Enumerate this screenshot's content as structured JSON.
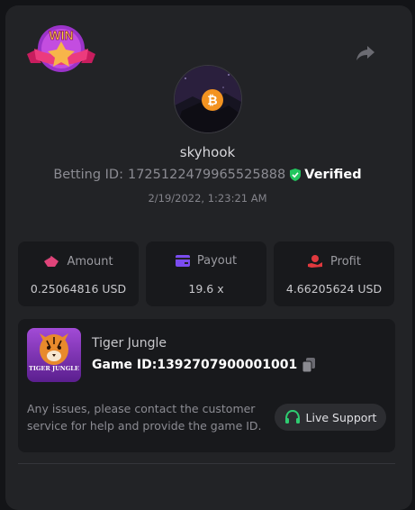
{
  "user": {
    "username": "skyhook",
    "betting_id_label": "Betting ID:",
    "betting_id": "1725122479965525888",
    "verified_label": "Verified",
    "datetime": "2/19/2022, 1:23:21 AM"
  },
  "badge": {
    "text": "WIN"
  },
  "stats": [
    {
      "label": "Amount",
      "value": "0.25064816 USD",
      "icon": "coins-icon",
      "color": "#e0447a"
    },
    {
      "label": "Payout",
      "value": "19.6 x",
      "icon": "wallet-icon",
      "color": "#7b4cf0"
    },
    {
      "label": "Profit",
      "value": "4.66205624 USD",
      "icon": "hand-coin-icon",
      "color": "#e0393e"
    }
  ],
  "game": {
    "name": "Tiger Jungle",
    "id_label": "Game ID:",
    "id": "1392707900001001",
    "thumb_title": "TIGER JUNGLE"
  },
  "support": {
    "message": "Any issues, please contact the customer service for help and provide the game ID.",
    "button_label": "Live Support"
  },
  "colors": {
    "background": "#131417",
    "card": "#222326",
    "panel": "#18191c",
    "verified_green": "#22c55e",
    "support_green": "#2ecc71"
  }
}
